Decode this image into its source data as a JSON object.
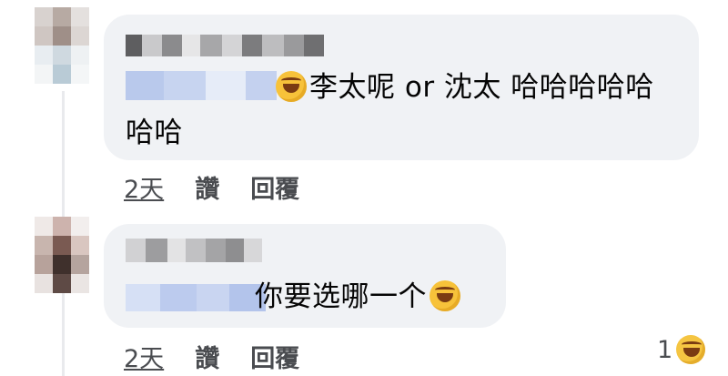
{
  "colors": {
    "bubble": "#f0f2f5",
    "meta_text": "#4a4c50",
    "reaction_emoji": "#f5c542"
  },
  "comments": [
    {
      "text_line1": "李太呢 or 沈太 哈哈哈哈哈",
      "text_line2": "哈哈",
      "emoji": "rolling-on-floor-laughing-emoji",
      "time": "2天",
      "like_label": "讚",
      "reply_label": "回覆"
    },
    {
      "text_line1": "你要选哪一个",
      "emoji": "rolling-on-floor-laughing-emoji",
      "time": "2天",
      "like_label": "讚",
      "reply_label": "回覆",
      "reaction_count": "1",
      "reaction_emoji": "laughing-emoji"
    }
  ]
}
